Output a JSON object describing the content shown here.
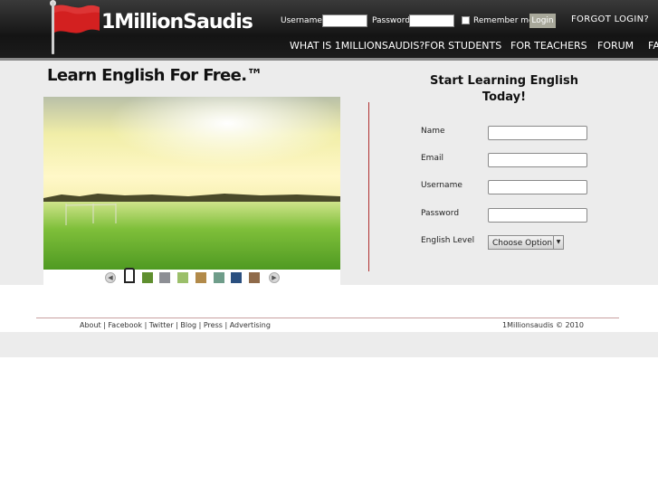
{
  "logo": {
    "text": "1MillionSaudis"
  },
  "login": {
    "username_label": "Username",
    "password_label": "Password",
    "remember_label": "Remember me",
    "login_button": "Login",
    "forgot_link": "FORGOT LOGIN?"
  },
  "nav": {
    "items": [
      "WHAT IS 1MILLIONSAUDIS?",
      "FOR STUDENTS",
      "FOR TEACHERS",
      "FORUM",
      "FA"
    ]
  },
  "main": {
    "headline": "Learn English For Free.™"
  },
  "signup": {
    "title_line1": "Start Learning English",
    "title_line2": "Today!",
    "name_label": "Name",
    "email_label": "Email",
    "username_label": "Username",
    "password_label": "Password",
    "level_label": "English Level",
    "level_select": "Choose Option"
  },
  "footer": {
    "links": "About | Facebook | Twitter | Blog | Press | Advertising",
    "copyright": "1Millionsaudis © 2010"
  },
  "colors": {
    "header_bg": "#1c1c1c",
    "main_bg": "#ececec",
    "flag_red": "#d32020",
    "divider": "#b03030"
  }
}
